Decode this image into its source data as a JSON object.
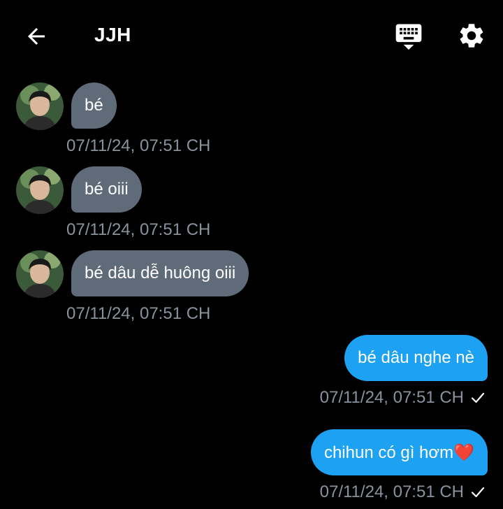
{
  "header": {
    "title": "JJH",
    "back_icon": "arrow-left-icon",
    "keyboard_icon": "keyboard-icon",
    "settings_icon": "gear-icon"
  },
  "colors": {
    "background": "#000000",
    "incoming_bubble": "#5f6b78",
    "outgoing_bubble": "#1da1f2",
    "timestamp": "#8a929c"
  },
  "messages": [
    {
      "direction": "incoming",
      "text": "bé",
      "timestamp": "07/11/24, 07:51 CH"
    },
    {
      "direction": "incoming",
      "text": "bé oiii",
      "timestamp": "07/11/24, 07:51 CH"
    },
    {
      "direction": "incoming",
      "text": "bé dâu dễ huông oiii",
      "timestamp": "07/11/24, 07:51 CH"
    },
    {
      "direction": "outgoing",
      "text": "bé dâu nghe nè",
      "timestamp": "07/11/24, 07:51 CH",
      "status_icon": "check-icon"
    },
    {
      "direction": "outgoing",
      "text": "chihun có gì hơm❤️",
      "timestamp": "07/11/24, 07:51 CH",
      "status_icon": "check-icon"
    }
  ]
}
